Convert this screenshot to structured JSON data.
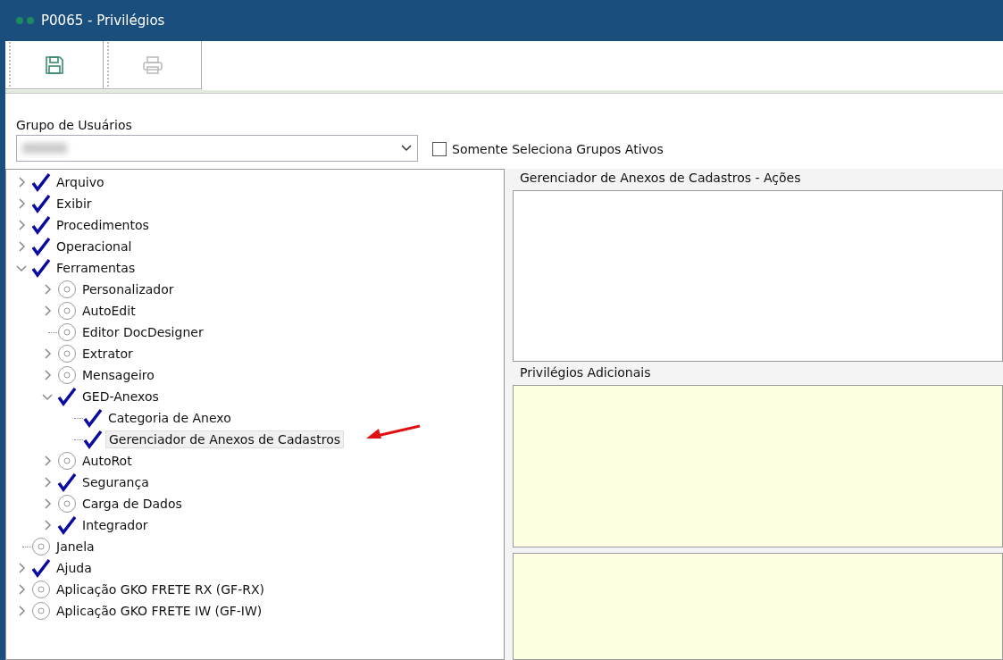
{
  "window": {
    "title": "P0065 - Privilégios"
  },
  "toolbar": {
    "buttons": [
      {
        "kind": "save",
        "disabled": false
      },
      {
        "kind": "print",
        "disabled": true
      }
    ]
  },
  "group_field": {
    "label": "Grupo de Usuários"
  },
  "active_only": {
    "label": "Somente Seleciona Grupos Ativos",
    "checked": false
  },
  "tree": [
    {
      "label": "Arquivo",
      "checked": true,
      "expanded": false,
      "selected": false
    },
    {
      "label": "Exibir",
      "checked": true,
      "expanded": false,
      "selected": false
    },
    {
      "label": "Procedimentos",
      "checked": true,
      "expanded": false,
      "selected": false
    },
    {
      "label": "Operacional",
      "checked": true,
      "expanded": false,
      "selected": false
    },
    {
      "label": "Ferramentas",
      "checked": true,
      "expanded": true,
      "selected": false,
      "children": [
        {
          "label": "Personalizador",
          "checked": false,
          "expanded": false,
          "selected": false
        },
        {
          "label": "AutoEdit",
          "checked": false,
          "expanded": false,
          "selected": false
        },
        {
          "label": "Editor DocDesigner",
          "checked": false,
          "selected": false
        },
        {
          "label": "Extrator",
          "checked": false,
          "expanded": false,
          "selected": false
        },
        {
          "label": "Mensageiro",
          "checked": false,
          "expanded": false,
          "selected": false
        },
        {
          "label": "GED-Anexos",
          "checked": true,
          "expanded": true,
          "selected": false,
          "children": [
            {
              "label": "Categoria de Anexo",
              "checked": true,
              "selected": false
            },
            {
              "label": "Gerenciador de Anexos de Cadastros",
              "checked": true,
              "selected": true
            }
          ]
        },
        {
          "label": "AutoRot",
          "checked": false,
          "expanded": false,
          "selected": false
        },
        {
          "label": "Segurança",
          "checked": true,
          "expanded": false,
          "selected": false
        },
        {
          "label": "Carga de Dados",
          "checked": false,
          "expanded": false,
          "selected": false
        },
        {
          "label": "Integrador",
          "checked": true,
          "expanded": false,
          "selected": false
        }
      ]
    },
    {
      "label": "Janela",
      "checked": false,
      "selected": false
    },
    {
      "label": "Ajuda",
      "checked": true,
      "expanded": false,
      "selected": false
    },
    {
      "label": "Aplicação GKO FRETE RX (GF-RX)",
      "checked": false,
      "expanded": false,
      "selected": false
    },
    {
      "label": "Aplicação GKO FRETE IW (GF-IW)",
      "checked": false,
      "expanded": false,
      "selected": false
    }
  ],
  "actions_panel": {
    "title": "Gerenciador de Anexos de Cadastros - Ações"
  },
  "extra_panel": {
    "title": "Privilégios Adicionais"
  }
}
